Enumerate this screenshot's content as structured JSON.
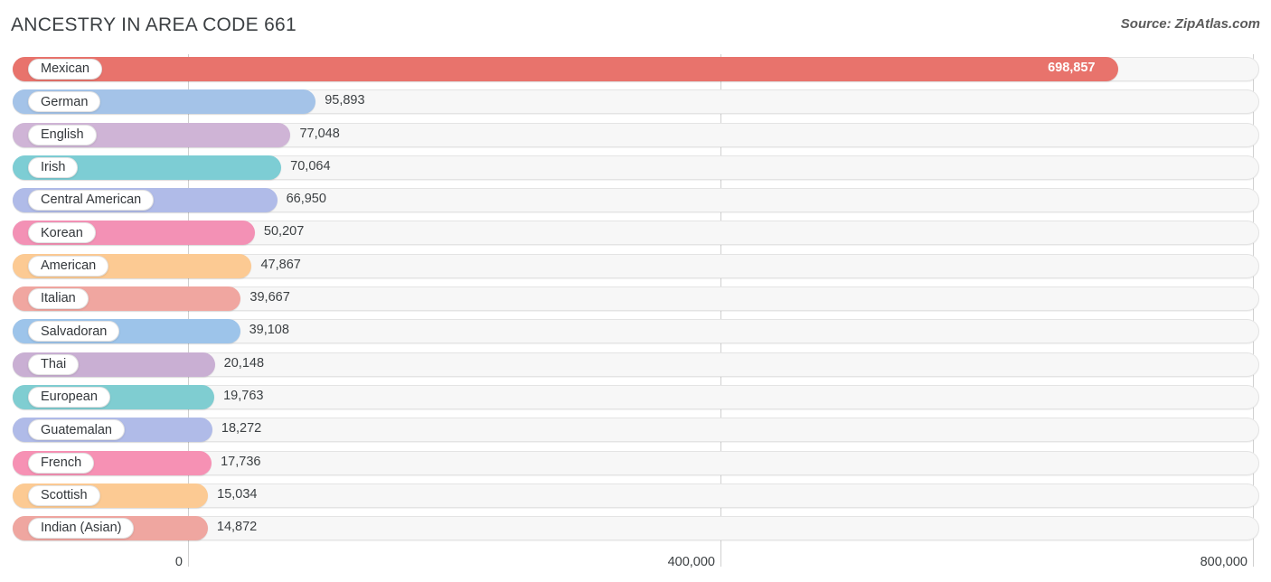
{
  "header": {
    "title": "ANCESTRY IN AREA CODE 661",
    "source": "Source: ZipAtlas.com"
  },
  "chart_data": {
    "type": "bar",
    "orientation": "horizontal",
    "title": "ANCESTRY IN AREA CODE 661",
    "xlabel": "",
    "ylabel": "",
    "xlim": [
      0,
      800000
    ],
    "xticks": [
      0,
      400000,
      800000
    ],
    "xtick_labels": [
      "0",
      "400,000",
      "800,000"
    ],
    "grid": true,
    "legend": false,
    "categories": [
      "Mexican",
      "German",
      "English",
      "Irish",
      "Central American",
      "Korean",
      "American",
      "Italian",
      "Salvadoran",
      "Thai",
      "European",
      "Guatemalan",
      "French",
      "Scottish",
      "Indian (Asian)"
    ],
    "values": [
      698857,
      95893,
      77048,
      70064,
      66950,
      50207,
      47867,
      39667,
      39108,
      20148,
      19763,
      18272,
      17736,
      15034,
      14872
    ],
    "value_labels": [
      "698,857",
      "95,893",
      "77,048",
      "70,064",
      "66,950",
      "50,207",
      "47,867",
      "39,667",
      "39,108",
      "20,148",
      "19,763",
      "18,272",
      "17,736",
      "15,034",
      "14,872"
    ],
    "colors": [
      "#e8736c",
      "#a4c3e8",
      "#cfb4d6",
      "#7dcdd4",
      "#b0bbe8",
      "#f391b5",
      "#fcca93",
      "#f0a6a0",
      "#9dc4ea",
      "#c9afd3",
      "#7fcdd1",
      "#b0bbe8",
      "#f691b4",
      "#fcca93",
      "#efa6a0"
    ]
  }
}
